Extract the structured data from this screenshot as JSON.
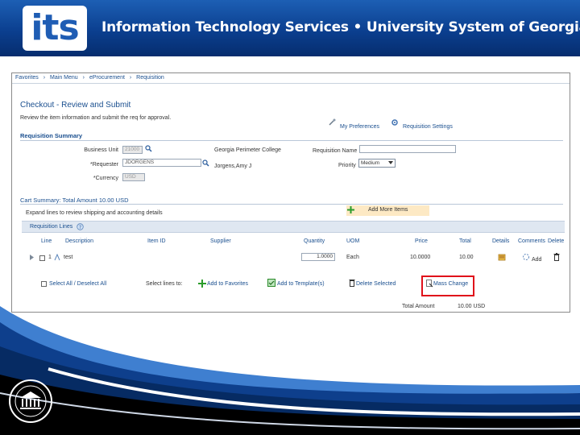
{
  "banner": {
    "logo_text": "its",
    "title": "Information Technology Services  •  University System of Georgia"
  },
  "breadcrumb": {
    "items": [
      "Favorites",
      "Main Menu",
      "eProcurement",
      "Requisition"
    ],
    "separator": "›"
  },
  "page": {
    "title": "Checkout - Review and Submit",
    "instructions": "Review the item information and submit the req for approval.",
    "links": {
      "my_preferences": "My Preferences",
      "requisition_settings": "Requisition Settings"
    }
  },
  "summary": {
    "section_title": "Requisition Summary",
    "business_unit_label": "Business Unit",
    "business_unit_value": "21000",
    "requester_label": "*Requester",
    "requester_value": "JDORGENS",
    "currency_label": "*Currency",
    "currency_value": "USD",
    "business_unit_desc": "Georgia Perimeter College",
    "requester_desc": "Jorgens,Amy J",
    "requisition_name_label": "Requisition Name",
    "requisition_name_value": "",
    "priority_label": "Priority",
    "priority_value": "Medium"
  },
  "cart": {
    "summary_title": "Cart Summary: Total Amount 10.00 USD",
    "expand_text": "Expand lines to review shipping and accounting details",
    "add_more_items": "Add More Items"
  },
  "lines": {
    "section_title": "Requisition Lines",
    "columns": [
      "Line",
      "Description",
      "Item ID",
      "Supplier",
      "Quantity",
      "UOM",
      "Price",
      "Total",
      "Details",
      "Comments",
      "Delete"
    ],
    "rows": [
      {
        "line": "1",
        "description": "test",
        "item_id": "",
        "supplier": "",
        "quantity": "1.0000",
        "uom": "Each",
        "price": "10.0000",
        "total": "10.00",
        "comments": "Add"
      }
    ]
  },
  "actions": {
    "select_all": "Select All / Deselect All",
    "select_lines_to": "Select lines to:",
    "add_to_favorites": "Add to Favorites",
    "add_to_templates": "Add to Template(s)",
    "delete_selected": "Delete Selected",
    "mass_change": "Mass Change"
  },
  "totals": {
    "label": "Total Amount",
    "value": "10.00 USD"
  },
  "colors": {
    "banner_blue": "#0b3f8f",
    "link_blue": "#1a4f8f",
    "highlight_red": "#e0101a",
    "add_more_bg": "#fde9c4"
  },
  "icons": [
    "search-icon",
    "help-icon",
    "expand-arrow-icon",
    "preferences-icon",
    "settings-icon",
    "add-items-icon",
    "favorites-icon",
    "template-icon",
    "delete-icon",
    "mass-change-icon",
    "details-icon",
    "comments-icon",
    "trash-icon",
    "university-seal-icon"
  ]
}
